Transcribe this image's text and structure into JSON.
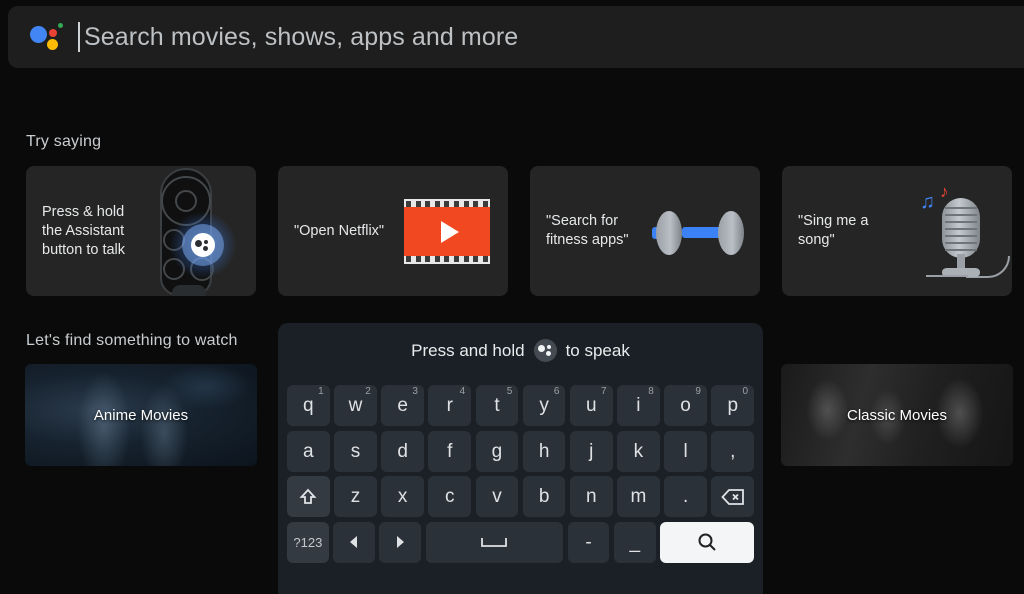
{
  "search": {
    "placeholder": "Search movies, shows, apps and more",
    "assistant_icon": "google-assistant-icon",
    "colors": {
      "blue": "#4285f4",
      "red": "#ea4335",
      "yellow": "#fbbc05",
      "green": "#34a853"
    }
  },
  "try_saying": {
    "title": "Try saying",
    "cards": [
      {
        "label": "Press & hold the Assistant button to talk",
        "art": "tv-remote-assistant-icon"
      },
      {
        "label": "\"Open Netflix\"",
        "art": "film-strip-play-icon"
      },
      {
        "label": "\"Search for fitness apps\"",
        "art": "dumbbell-icon"
      },
      {
        "label": "\"Sing me a song\"",
        "art": "vintage-microphone-icon"
      }
    ]
  },
  "watch": {
    "title": "Let's find something to watch",
    "cards": [
      {
        "label": "Anime Movies"
      },
      {
        "label": "Classic Movies"
      }
    ]
  },
  "keyboard": {
    "hint_before": "Press and hold",
    "hint_icon": "assistant-mic-icon",
    "hint_after": "to speak",
    "rows": [
      [
        {
          "label": "q",
          "sup": "1"
        },
        {
          "label": "w",
          "sup": "2"
        },
        {
          "label": "e",
          "sup": "3"
        },
        {
          "label": "r",
          "sup": "4"
        },
        {
          "label": "t",
          "sup": "5"
        },
        {
          "label": "y",
          "sup": "6"
        },
        {
          "label": "u",
          "sup": "7"
        },
        {
          "label": "i",
          "sup": "8"
        },
        {
          "label": "o",
          "sup": "9"
        },
        {
          "label": "p",
          "sup": "0"
        }
      ],
      [
        {
          "label": "a"
        },
        {
          "label": "s"
        },
        {
          "label": "d"
        },
        {
          "label": "f"
        },
        {
          "label": "g"
        },
        {
          "label": "h"
        },
        {
          "label": "j"
        },
        {
          "label": "k"
        },
        {
          "label": "l"
        },
        {
          "label": ","
        }
      ],
      [
        {
          "label": "",
          "icon": "shift-icon"
        },
        {
          "label": "z"
        },
        {
          "label": "x"
        },
        {
          "label": "c"
        },
        {
          "label": "v"
        },
        {
          "label": "b"
        },
        {
          "label": "n"
        },
        {
          "label": "m"
        },
        {
          "label": "."
        },
        {
          "label": "",
          "icon": "backspace-icon"
        }
      ],
      [
        {
          "label": "?123"
        },
        {
          "label": "",
          "icon": "arrow-left-icon"
        },
        {
          "label": "",
          "icon": "arrow-right-icon"
        },
        {
          "label": "",
          "icon": "space-icon"
        },
        {
          "label": "-"
        },
        {
          "label": "_"
        },
        {
          "label": "",
          "icon": "search-icon",
          "focused": true
        }
      ]
    ]
  },
  "theme": {
    "background": "#0a0a0a",
    "search_bar_bg": "#1e1e1e",
    "card_bg": "#252525",
    "keyboard_bg": "#1b2026",
    "key_bg": "#2b3139",
    "focused_key_bg": "#f4f5f6"
  }
}
